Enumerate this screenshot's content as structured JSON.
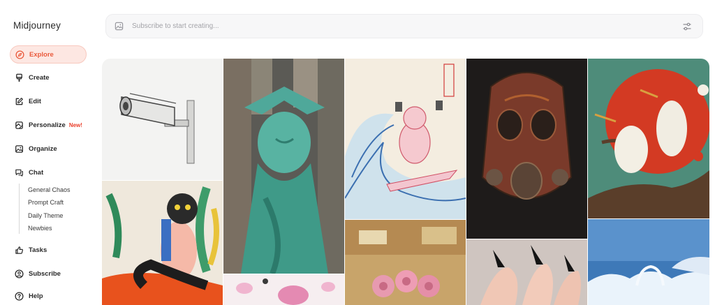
{
  "app": {
    "name": "Midjourney"
  },
  "nav": {
    "explore": "Explore",
    "create": "Create",
    "edit": "Edit",
    "personalize": "Personalize",
    "personalize_badge": "New!",
    "organize": "Organize",
    "chat": "Chat",
    "chat_rooms": [
      "General Chaos",
      "Prompt Craft",
      "Daily Theme",
      "Newbies"
    ],
    "tasks": "Tasks",
    "subscribe": "Subscribe",
    "help": "Help"
  },
  "search": {
    "placeholder": "Subscribe to start creating..."
  },
  "colors": {
    "accent": "#ea5a3c",
    "accent_bg": "#fde7e2",
    "badge": "#ea3e2a"
  },
  "gallery": {
    "images": [
      {
        "subject": "security camera sketch"
      },
      {
        "subject": "statue of liberty over city"
      },
      {
        "subject": "cat surfing wave with pistols"
      },
      {
        "subject": "rusted gas mask"
      },
      {
        "subject": "storks on branch with red sun"
      },
      {
        "subject": "painted cat with leaves"
      },
      {
        "subject": "pink highland cattle pattern"
      },
      {
        "subject": "pink hair rollers"
      },
      {
        "subject": "black stiletto nails"
      },
      {
        "subject": "ice and clouds sculpture"
      }
    ]
  }
}
